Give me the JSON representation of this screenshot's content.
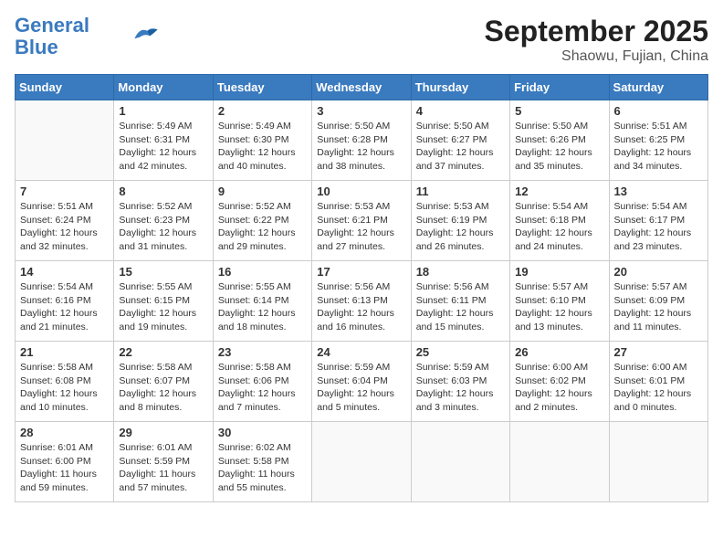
{
  "header": {
    "logo_line1": "General",
    "logo_line2": "Blue",
    "title": "September 2025",
    "subtitle": "Shaowu, Fujian, China"
  },
  "weekdays": [
    "Sunday",
    "Monday",
    "Tuesday",
    "Wednesday",
    "Thursday",
    "Friday",
    "Saturday"
  ],
  "weeks": [
    [
      {
        "day": "",
        "detail": ""
      },
      {
        "day": "1",
        "detail": "Sunrise: 5:49 AM\nSunset: 6:31 PM\nDaylight: 12 hours\nand 42 minutes."
      },
      {
        "day": "2",
        "detail": "Sunrise: 5:49 AM\nSunset: 6:30 PM\nDaylight: 12 hours\nand 40 minutes."
      },
      {
        "day": "3",
        "detail": "Sunrise: 5:50 AM\nSunset: 6:28 PM\nDaylight: 12 hours\nand 38 minutes."
      },
      {
        "day": "4",
        "detail": "Sunrise: 5:50 AM\nSunset: 6:27 PM\nDaylight: 12 hours\nand 37 minutes."
      },
      {
        "day": "5",
        "detail": "Sunrise: 5:50 AM\nSunset: 6:26 PM\nDaylight: 12 hours\nand 35 minutes."
      },
      {
        "day": "6",
        "detail": "Sunrise: 5:51 AM\nSunset: 6:25 PM\nDaylight: 12 hours\nand 34 minutes."
      }
    ],
    [
      {
        "day": "7",
        "detail": "Sunrise: 5:51 AM\nSunset: 6:24 PM\nDaylight: 12 hours\nand 32 minutes."
      },
      {
        "day": "8",
        "detail": "Sunrise: 5:52 AM\nSunset: 6:23 PM\nDaylight: 12 hours\nand 31 minutes."
      },
      {
        "day": "9",
        "detail": "Sunrise: 5:52 AM\nSunset: 6:22 PM\nDaylight: 12 hours\nand 29 minutes."
      },
      {
        "day": "10",
        "detail": "Sunrise: 5:53 AM\nSunset: 6:21 PM\nDaylight: 12 hours\nand 27 minutes."
      },
      {
        "day": "11",
        "detail": "Sunrise: 5:53 AM\nSunset: 6:19 PM\nDaylight: 12 hours\nand 26 minutes."
      },
      {
        "day": "12",
        "detail": "Sunrise: 5:54 AM\nSunset: 6:18 PM\nDaylight: 12 hours\nand 24 minutes."
      },
      {
        "day": "13",
        "detail": "Sunrise: 5:54 AM\nSunset: 6:17 PM\nDaylight: 12 hours\nand 23 minutes."
      }
    ],
    [
      {
        "day": "14",
        "detail": "Sunrise: 5:54 AM\nSunset: 6:16 PM\nDaylight: 12 hours\nand 21 minutes."
      },
      {
        "day": "15",
        "detail": "Sunrise: 5:55 AM\nSunset: 6:15 PM\nDaylight: 12 hours\nand 19 minutes."
      },
      {
        "day": "16",
        "detail": "Sunrise: 5:55 AM\nSunset: 6:14 PM\nDaylight: 12 hours\nand 18 minutes."
      },
      {
        "day": "17",
        "detail": "Sunrise: 5:56 AM\nSunset: 6:13 PM\nDaylight: 12 hours\nand 16 minutes."
      },
      {
        "day": "18",
        "detail": "Sunrise: 5:56 AM\nSunset: 6:11 PM\nDaylight: 12 hours\nand 15 minutes."
      },
      {
        "day": "19",
        "detail": "Sunrise: 5:57 AM\nSunset: 6:10 PM\nDaylight: 12 hours\nand 13 minutes."
      },
      {
        "day": "20",
        "detail": "Sunrise: 5:57 AM\nSunset: 6:09 PM\nDaylight: 12 hours\nand 11 minutes."
      }
    ],
    [
      {
        "day": "21",
        "detail": "Sunrise: 5:58 AM\nSunset: 6:08 PM\nDaylight: 12 hours\nand 10 minutes."
      },
      {
        "day": "22",
        "detail": "Sunrise: 5:58 AM\nSunset: 6:07 PM\nDaylight: 12 hours\nand 8 minutes."
      },
      {
        "day": "23",
        "detail": "Sunrise: 5:58 AM\nSunset: 6:06 PM\nDaylight: 12 hours\nand 7 minutes."
      },
      {
        "day": "24",
        "detail": "Sunrise: 5:59 AM\nSunset: 6:04 PM\nDaylight: 12 hours\nand 5 minutes."
      },
      {
        "day": "25",
        "detail": "Sunrise: 5:59 AM\nSunset: 6:03 PM\nDaylight: 12 hours\nand 3 minutes."
      },
      {
        "day": "26",
        "detail": "Sunrise: 6:00 AM\nSunset: 6:02 PM\nDaylight: 12 hours\nand 2 minutes."
      },
      {
        "day": "27",
        "detail": "Sunrise: 6:00 AM\nSunset: 6:01 PM\nDaylight: 12 hours\nand 0 minutes."
      }
    ],
    [
      {
        "day": "28",
        "detail": "Sunrise: 6:01 AM\nSunset: 6:00 PM\nDaylight: 11 hours\nand 59 minutes."
      },
      {
        "day": "29",
        "detail": "Sunrise: 6:01 AM\nSunset: 5:59 PM\nDaylight: 11 hours\nand 57 minutes."
      },
      {
        "day": "30",
        "detail": "Sunrise: 6:02 AM\nSunset: 5:58 PM\nDaylight: 11 hours\nand 55 minutes."
      },
      {
        "day": "",
        "detail": ""
      },
      {
        "day": "",
        "detail": ""
      },
      {
        "day": "",
        "detail": ""
      },
      {
        "day": "",
        "detail": ""
      }
    ]
  ]
}
